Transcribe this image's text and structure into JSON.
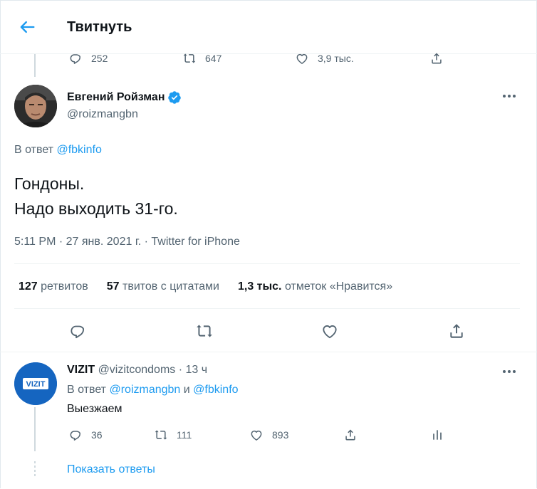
{
  "header": {
    "title": "Твитнуть"
  },
  "prev_tweet_actions": {
    "replies": "252",
    "retweets": "647",
    "likes": "3,9 тыс."
  },
  "tweet": {
    "author_name": "Евгений Ройзман",
    "author_handle": "@roizmangbn",
    "reply_prefix": "В ответ",
    "reply_to": "@fbkinfo",
    "text_line1": "Гондоны.",
    "text_line2": "Надо выходить 31-го.",
    "time": "5:11 PM",
    "sep": "·",
    "date": "27 янв. 2021 г.",
    "source": "Twitter for iPhone",
    "stats": {
      "retweets_count": "127",
      "retweets_label": "ретвитов",
      "quotes_count": "57",
      "quotes_label": "твитов с цитатами",
      "likes_count": "1,3 тыс.",
      "likes_label": "отметок «Нравится»"
    }
  },
  "reply": {
    "author_name": "VIZIT",
    "author_handle": "@vizitcondoms",
    "sep": "·",
    "age": "13 ч",
    "avatar_text": "VIZIT",
    "reply_prefix": "В ответ",
    "reply_to_1": "@roizmangbn",
    "conj": "и",
    "reply_to_2": "@fbkinfo",
    "text": "Выезжаем",
    "actions": {
      "replies": "36",
      "retweets": "111",
      "likes": "893"
    }
  },
  "show_replies": "Показать ответы",
  "colors": {
    "accent": "#1d9bf0",
    "verified": "#1d9bf0",
    "muted": "#536471",
    "vizit_blue": "#1565c0"
  },
  "icons": [
    "back-arrow-icon",
    "reply-icon",
    "retweet-icon",
    "like-icon",
    "share-icon",
    "verified-icon",
    "more-icon",
    "analytics-icon"
  ]
}
